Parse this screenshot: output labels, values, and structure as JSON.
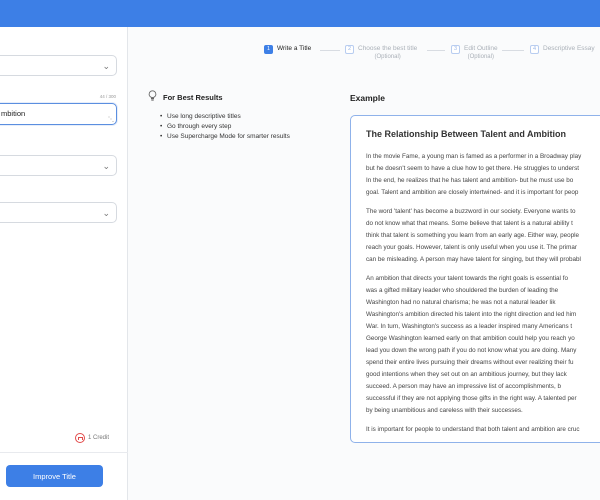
{
  "left_panel": {
    "input_value": "mbition",
    "counter": "44 / 300",
    "credit_label": "1 Credit",
    "improve_button": "Improve Title"
  },
  "stepper": {
    "steps": [
      {
        "num": "1",
        "label": "Write a Title",
        "sub": ""
      },
      {
        "num": "2",
        "label": "Choose the best title",
        "sub": "(Optional)"
      },
      {
        "num": "3",
        "label": "Edit Outline",
        "sub": "(Optional)"
      },
      {
        "num": "4",
        "label": "Descriptive Essay",
        "sub": ""
      }
    ]
  },
  "tips": {
    "title": "For Best Results",
    "items": [
      "Use long descriptive titles",
      "Go through every step",
      "Use Supercharge Mode for smarter results"
    ]
  },
  "example": {
    "label": "Example",
    "essay_title": "The Relationship Between Talent and Ambition",
    "paragraphs": [
      [
        "In the movie Fame, a young man is famed as a performer in a Broadway play",
        "but he doesn't seem to have a clue how to get there. He struggles to underst",
        "In the end, he realizes that he has talent and ambition- but he must use bo",
        "goal. Talent and ambition are closely intertwined- and it is important for peop"
      ],
      [
        "The word 'talent' has become a buzzword in our society. Everyone wants to",
        "do not know what that means. Some believe that talent is a natural ability t",
        "think that talent is something you learn from an early age. Either way, people",
        "reach your goals. However, talent is only useful when you use it. The primar",
        "can be misleading. A person may have talent for singing, but they will probabl"
      ],
      [
        "An ambition that directs your talent towards the right goals is essential fo",
        "was a gifted military leader who shouldered the burden of leading the",
        "Washington had no natural charisma; he was not a natural leader lik",
        "Washington's ambition directed his talent into the right direction and led him",
        "War. In turn, Washington's success as a leader inspired many Americans t",
        "George Washington learned early on that ambition could help you reach yo",
        "lead you down the wrong path if you do not know what you are doing. Many",
        "spend their entire lives pursuing their dreams without ever realizing their fu",
        "good intentions when they set out on an ambitious journey, but they lack",
        "succeed. A person may have an impressive list of accomplishments, b",
        "successful if they are not applying those gifts in the right way. A talented per",
        "by being unambitious and careless with their successes."
      ],
      [
        "It is important for people to understand that both talent and ambition are cruc"
      ]
    ]
  },
  "colors": {
    "brand": "#3d7fe6",
    "card_border": "#8fb2ea",
    "credit": "#e24a4a"
  }
}
